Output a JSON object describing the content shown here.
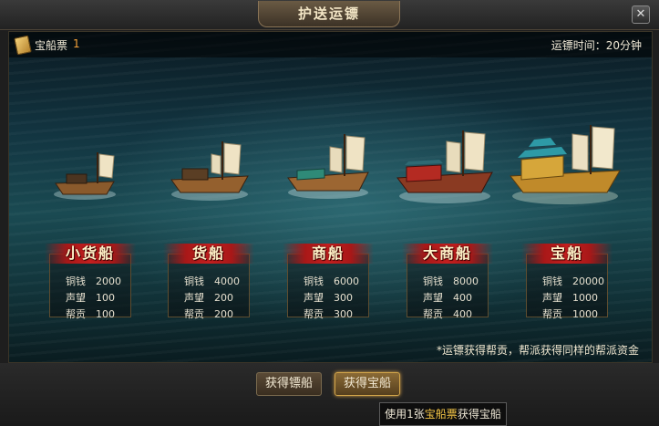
{
  "window": {
    "title": "护送运镖",
    "close_icon": "close-icon"
  },
  "info": {
    "ticket_label": "宝船票",
    "ticket_count": "1",
    "ticket_icon": "ticket-icon",
    "time_label": "运镖时间：20分钟"
  },
  "ships": [
    {
      "name": "小货船",
      "rows": [
        {
          "k": "铜钱",
          "v": "2000"
        },
        {
          "k": "声望",
          "v": "100"
        },
        {
          "k": "帮贡",
          "v": "100"
        }
      ]
    },
    {
      "name": "货船",
      "rows": [
        {
          "k": "铜钱",
          "v": "4000"
        },
        {
          "k": "声望",
          "v": "200"
        },
        {
          "k": "帮贡",
          "v": "200"
        }
      ]
    },
    {
      "name": "商船",
      "rows": [
        {
          "k": "铜钱",
          "v": "6000"
        },
        {
          "k": "声望",
          "v": "300"
        },
        {
          "k": "帮贡",
          "v": "300"
        }
      ]
    },
    {
      "name": "大商船",
      "rows": [
        {
          "k": "铜钱",
          "v": "8000"
        },
        {
          "k": "声望",
          "v": "400"
        },
        {
          "k": "帮贡",
          "v": "400"
        }
      ]
    },
    {
      "name": "宝船",
      "rows": [
        {
          "k": "铜钱",
          "v": "20000"
        },
        {
          "k": "声望",
          "v": "1000"
        },
        {
          "k": "帮贡",
          "v": "1000"
        }
      ]
    }
  ],
  "note": "*运镖获得帮贡，帮派获得同样的帮派资金",
  "buttons": {
    "escort": "获得镖船",
    "treasure": "获得宝船"
  },
  "tooltip": {
    "pre": "使用1张",
    "highlight": "宝船票",
    "post": "获得宝船"
  },
  "colors": {
    "accent": "#c41f1f",
    "highlight": "#f5c646",
    "ticket_count": "#f6a23a"
  }
}
